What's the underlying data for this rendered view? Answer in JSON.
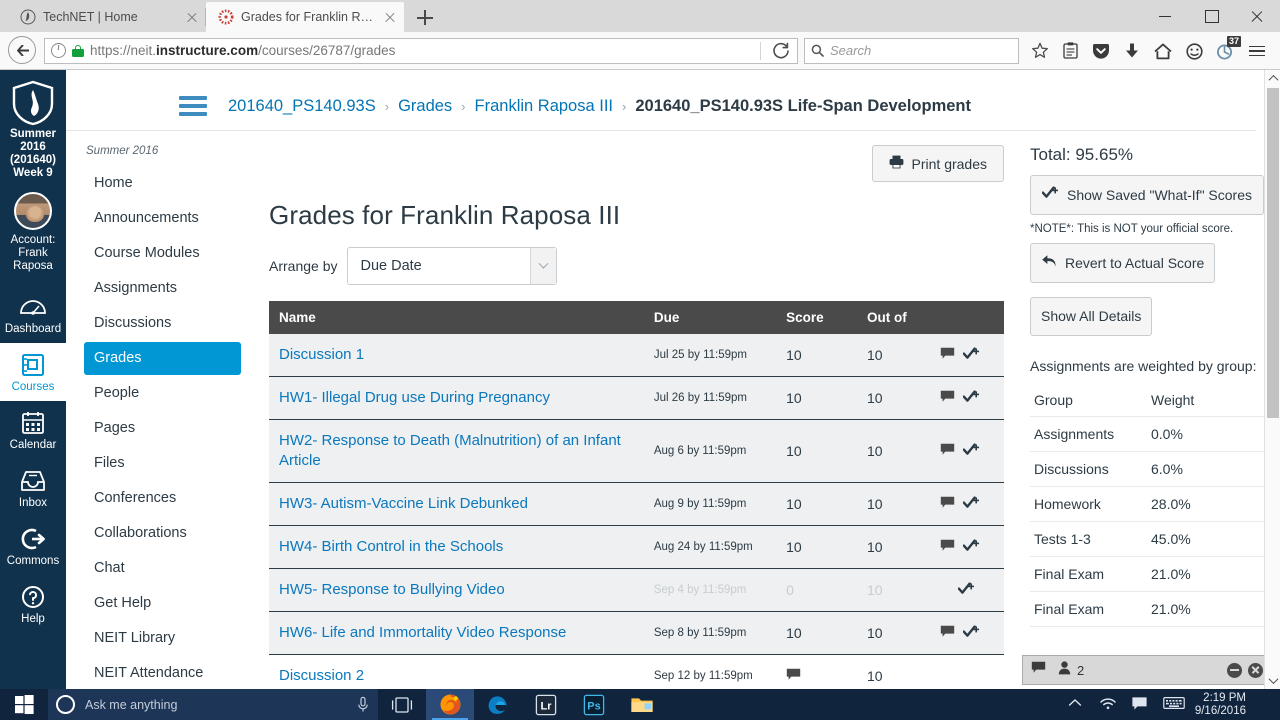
{
  "browser": {
    "tabs": [
      {
        "title": "TechNET | Home",
        "favicon": "technet-icon",
        "active": false
      },
      {
        "title": "Grades for Franklin Rapos...",
        "favicon": "canvas-icon",
        "active": true
      }
    ],
    "new_tab_label": "+",
    "url_prefix": "https://neit.",
    "url_bold": "instructure.com",
    "url_suffix": "/courses/26787/grades",
    "search_placeholder": "Search",
    "toolbar_icons": [
      "star-icon",
      "reader-icon",
      "pocket-icon",
      "downloads-icon",
      "home-icon",
      "sync-icon",
      "addon-icon",
      "menu-icon"
    ],
    "addon_badge": "37",
    "window_controls": [
      "minimize-button",
      "maximize-button",
      "close-button"
    ]
  },
  "globalnav": {
    "logo": "neit-shield-logo",
    "term": "Summer 2016 (201640) Week 9",
    "account_label": "Account: Frank Raposa",
    "items": [
      {
        "label": "Dashboard",
        "icon": "dashboard-icon",
        "active": false
      },
      {
        "label": "Courses",
        "icon": "courses-icon",
        "active": true
      },
      {
        "label": "Calendar",
        "icon": "calendar-icon",
        "active": false
      },
      {
        "label": "Inbox",
        "icon": "inbox-icon",
        "active": false
      },
      {
        "label": "Commons",
        "icon": "commons-icon",
        "active": false
      },
      {
        "label": "Help",
        "icon": "help-icon",
        "active": false
      }
    ]
  },
  "breadcrumb": {
    "items": [
      {
        "label": "201640_PS140.93S",
        "current": false
      },
      {
        "label": "Grades",
        "current": false
      },
      {
        "label": "Franklin Raposa III",
        "current": false
      },
      {
        "label": "201640_PS140.93S Life-Span Development",
        "current": true
      }
    ],
    "separator": "›"
  },
  "coursenav": {
    "term": "Summer 2016",
    "items": [
      {
        "label": "Home",
        "active": false
      },
      {
        "label": "Announcements",
        "active": false
      },
      {
        "label": "Course Modules",
        "active": false
      },
      {
        "label": "Assignments",
        "active": false
      },
      {
        "label": "Discussions",
        "active": false
      },
      {
        "label": "Grades",
        "active": true
      },
      {
        "label": "People",
        "active": false
      },
      {
        "label": "Pages",
        "active": false
      },
      {
        "label": "Files",
        "active": false
      },
      {
        "label": "Conferences",
        "active": false
      },
      {
        "label": "Collaborations",
        "active": false
      },
      {
        "label": "Chat",
        "active": false
      },
      {
        "label": "Get Help",
        "active": false
      },
      {
        "label": "NEIT Library",
        "active": false
      },
      {
        "label": "NEIT Attendance",
        "active": false
      }
    ]
  },
  "main": {
    "print_button": "Print grades",
    "print_icon": "printer-icon",
    "title": "Grades for Franklin Raposa III",
    "arrange_label": "Arrange by",
    "arrange_value": "Due Date",
    "table": {
      "headers": [
        "Name",
        "Due",
        "Score",
        "Out of",
        ""
      ],
      "rows": [
        {
          "name": "Discussion 1",
          "due": "Jul 25 by 11:59pm",
          "score": "10",
          "out_of": "10",
          "icons": [
            "comment-icon",
            "whatif-icon"
          ],
          "muted": false,
          "shaded": true
        },
        {
          "name": "HW1- Illegal Drug use During Pregnancy",
          "due": "Jul 26 by 11:59pm",
          "score": "10",
          "out_of": "10",
          "icons": [
            "comment-icon",
            "whatif-icon"
          ],
          "muted": false,
          "shaded": true
        },
        {
          "name": "HW2- Response to Death (Malnutrition) of an Infant Article",
          "due": "Aug 6 by 11:59pm",
          "score": "10",
          "out_of": "10",
          "icons": [
            "comment-icon",
            "whatif-icon"
          ],
          "muted": false,
          "shaded": true
        },
        {
          "name": "HW3- Autism-Vaccine Link Debunked",
          "due": "Aug 9 by 11:59pm",
          "score": "10",
          "out_of": "10",
          "icons": [
            "comment-icon",
            "whatif-icon"
          ],
          "muted": false,
          "shaded": true
        },
        {
          "name": "HW4- Birth Control in the Schools",
          "due": "Aug 24 by 11:59pm",
          "score": "10",
          "out_of": "10",
          "icons": [
            "comment-icon",
            "whatif-icon"
          ],
          "muted": false,
          "shaded": true
        },
        {
          "name": "HW5- Response to Bullying Video",
          "due": "Sep 4 by 11:59pm",
          "score": "0",
          "out_of": "10",
          "icons": [
            "whatif-icon"
          ],
          "muted": true,
          "shaded": true
        },
        {
          "name": "HW6- Life and Immortality Video Response",
          "due": "Sep 8 by 11:59pm",
          "score": "10",
          "out_of": "10",
          "icons": [
            "comment-icon",
            "whatif-icon"
          ],
          "muted": false,
          "shaded": true
        },
        {
          "name": "Discussion 2",
          "due": "Sep 12 by 11:59pm",
          "score": "",
          "out_of": "10",
          "icons": [],
          "muted": false,
          "shaded": false
        }
      ]
    }
  },
  "sidebar": {
    "total_label": "Total: 95.65%",
    "show_whatif_button": "Show Saved \"What-If\" Scores",
    "whatif_icon": "whatif-icon",
    "note": "*NOTE*: This is NOT your official score.",
    "revert_button": "Revert to Actual Score",
    "revert_icon": "revert-arrow-icon",
    "show_details_button": "Show All Details",
    "weights_intro": "Assignments are weighted by group:",
    "weights_headers": [
      "Group",
      "Weight"
    ],
    "weights": [
      {
        "group": "Assignments",
        "weight": "0.0%"
      },
      {
        "group": "Discussions",
        "weight": "6.0%"
      },
      {
        "group": "Homework",
        "weight": "28.0%"
      },
      {
        "group": "Tests 1-3",
        "weight": "45.0%"
      },
      {
        "group": "Final Exam",
        "weight": "21.0%"
      },
      {
        "group": "Final Exam",
        "weight": "21.0%"
      }
    ]
  },
  "chatbar": {
    "chat_icon": "chat-bubble-icon",
    "people_icon": "person-icon",
    "count": "2",
    "minimize_icon": "minimize-icon",
    "close_icon": "close-icon"
  },
  "taskbar": {
    "start_icon": "windows-start-icon",
    "search_placeholder": "Ask me anything",
    "cortana_icon": "cortana-ring-icon",
    "mic_icon": "microphone-icon",
    "taskview_icon": "task-view-icon",
    "apps": [
      {
        "name": "firefox-taskbar-icon",
        "active": true
      },
      {
        "name": "edge-taskbar-icon",
        "active": false
      },
      {
        "name": "lightroom-taskbar-icon",
        "label": "Lr",
        "active": false
      },
      {
        "name": "photoshop-taskbar-icon",
        "label": "Ps",
        "active": false
      },
      {
        "name": "file-explorer-taskbar-icon",
        "active": false
      }
    ],
    "tray": [
      "show-hidden-icons",
      "wifi-icon",
      "action-center-icon",
      "touch-keyboard-icon"
    ],
    "time": "2:19 PM",
    "date": "9/16/2016"
  },
  "colors": {
    "canvas_dark": "#11324c",
    "canvas_blue": "#0097d4",
    "link_blue": "#0374b5",
    "table_header": "#4a4a4a",
    "taskbar": "#11243e"
  }
}
